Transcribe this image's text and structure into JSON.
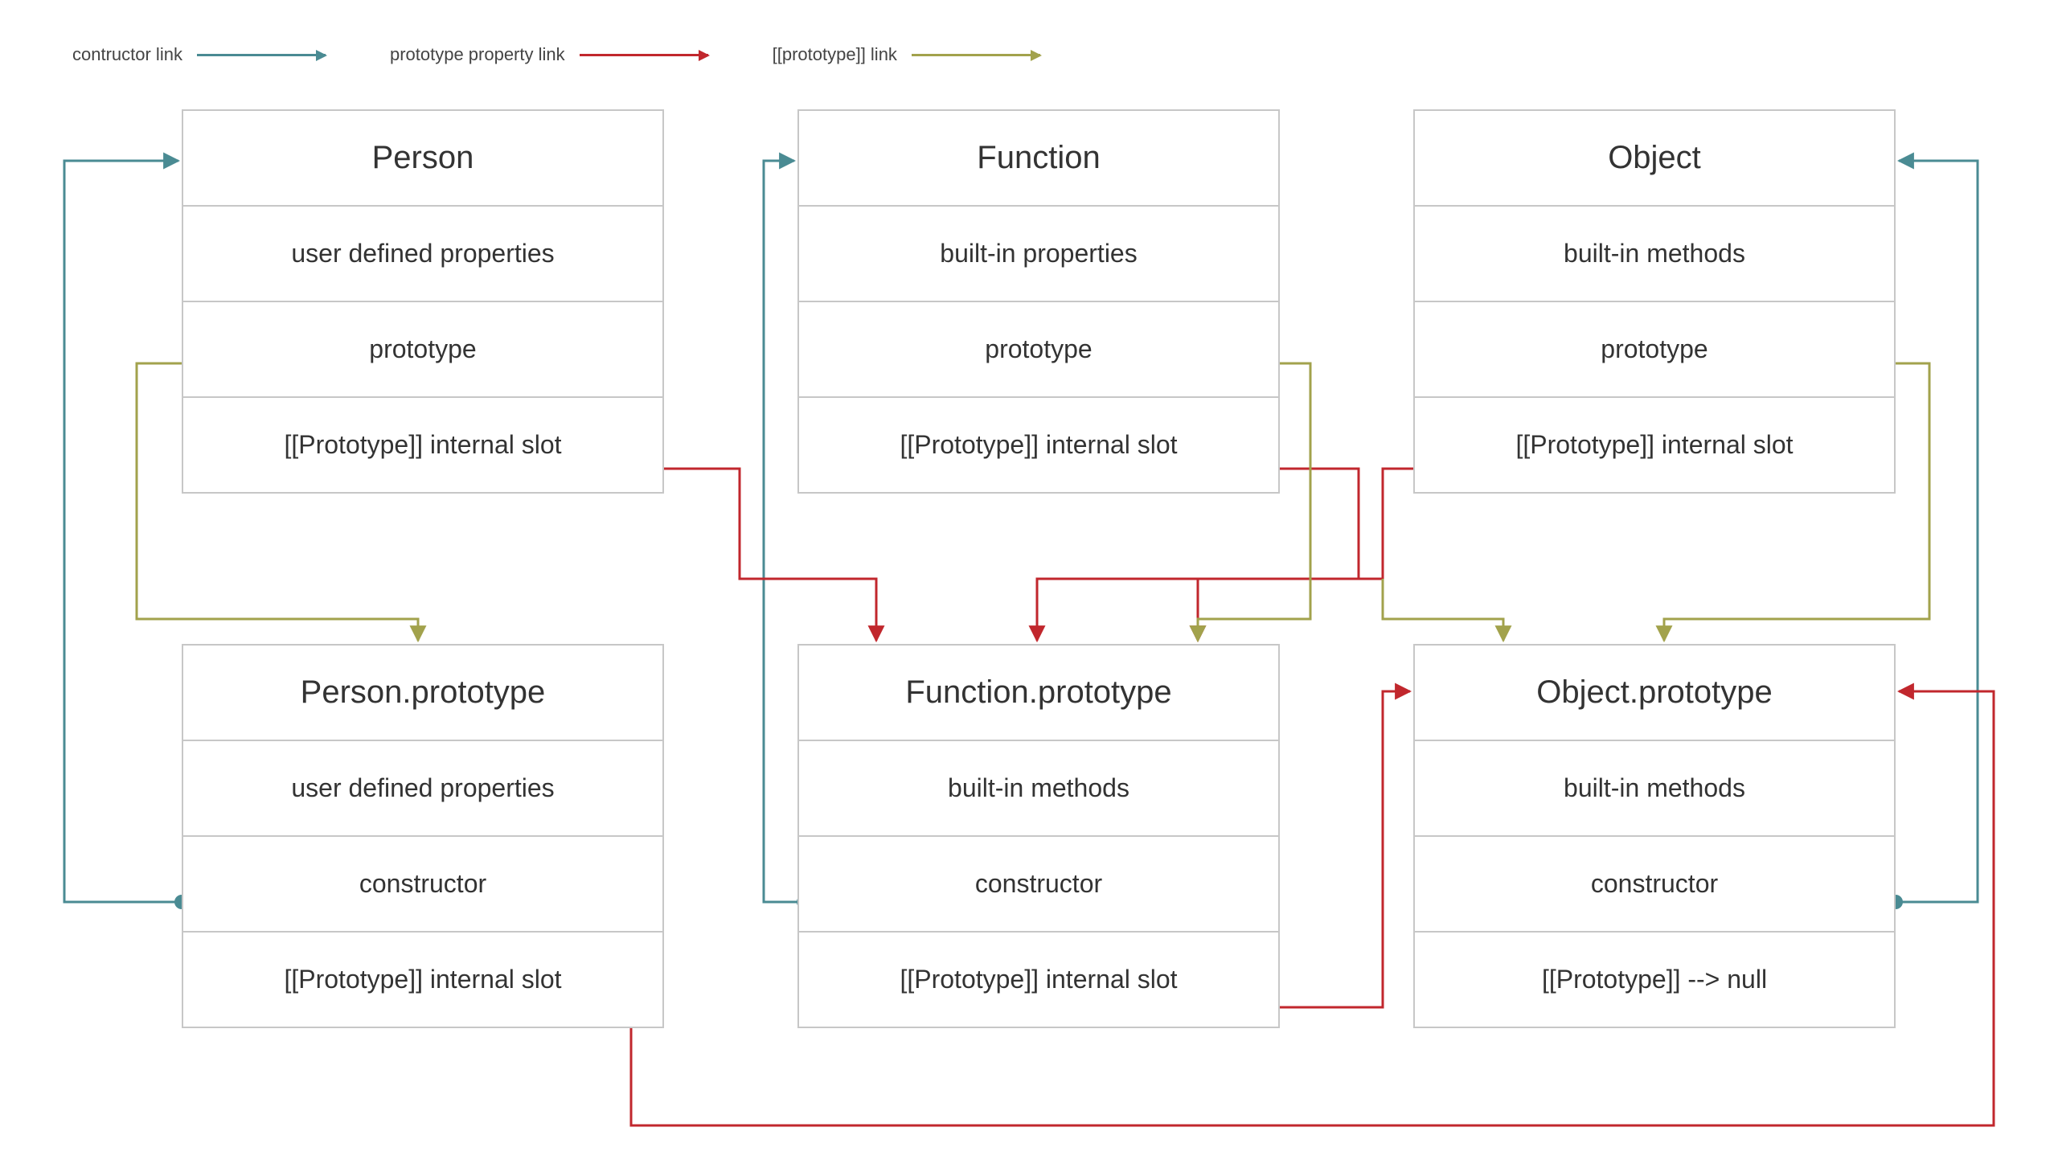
{
  "legend": {
    "constructor_label": "contructor link",
    "prototype_label": "prototype property link",
    "internal_label": "[[prototype]] link"
  },
  "colors": {
    "constructor": "#4a8b93",
    "prototype": "#c1272d",
    "internal": "#a2a24c",
    "border": "#c7c7c7"
  },
  "person": {
    "title": "Person",
    "row1": "user defined properties",
    "row2": "prototype",
    "row3": "[[Prototype]] internal slot"
  },
  "function": {
    "title": "Function",
    "row1": "built-in properties",
    "row2": "prototype",
    "row3": "[[Prototype]] internal slot"
  },
  "object": {
    "title": "Object",
    "row1": "built-in methods",
    "row2": "prototype",
    "row3": "[[Prototype]] internal slot"
  },
  "person_proto": {
    "title": "Person.prototype",
    "row1": "user defined properties",
    "row2": "constructor",
    "row3": "[[Prototype]] internal slot"
  },
  "function_proto": {
    "title": "Function.prototype",
    "row1": "built-in methods",
    "row2": "constructor",
    "row3": "[[Prototype]] internal slot"
  },
  "object_proto": {
    "title": "Object.prototype",
    "row1": "built-in methods",
    "row2": "constructor",
    "row3": "[[Prototype]] --> null"
  }
}
